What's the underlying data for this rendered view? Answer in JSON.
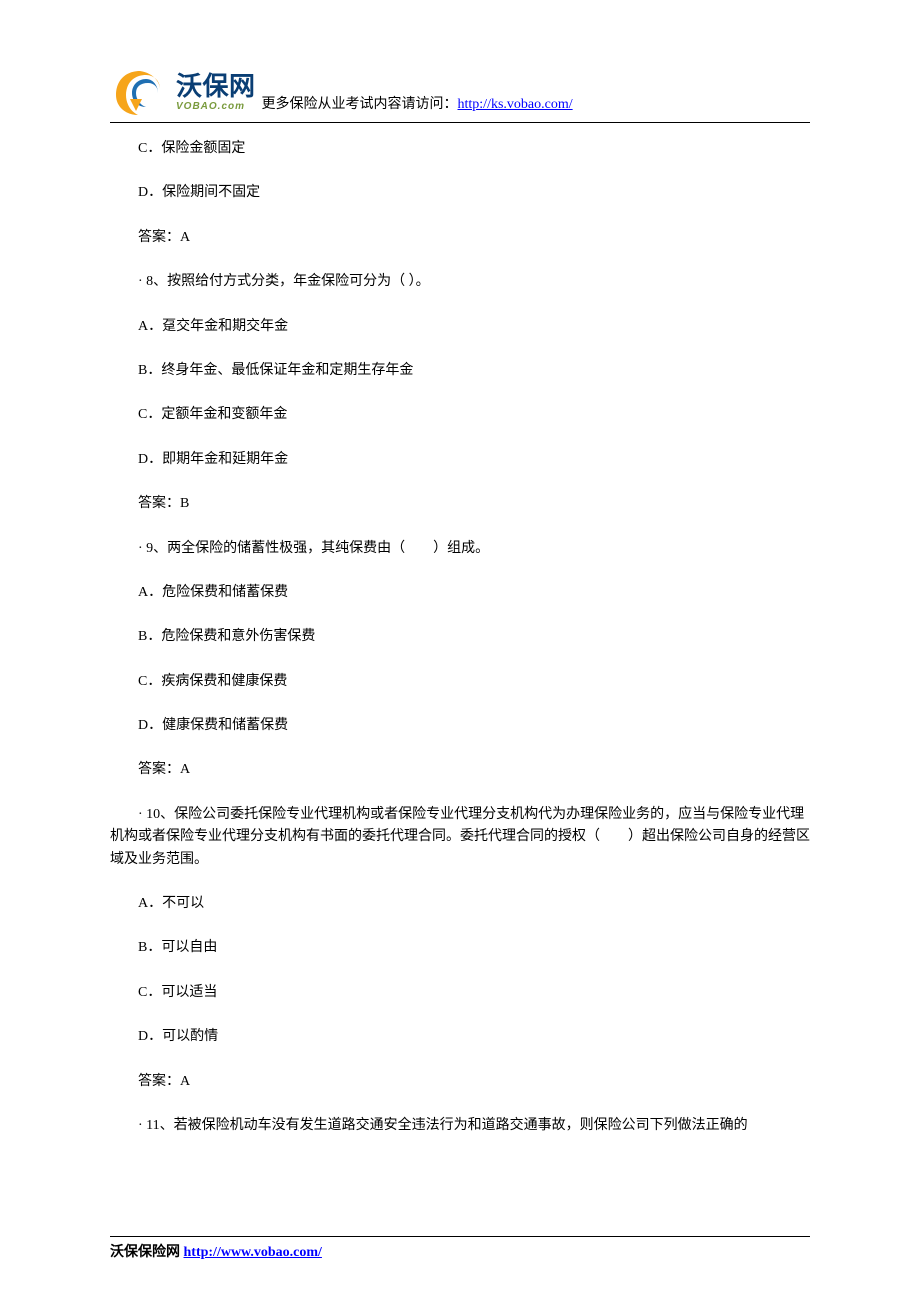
{
  "brand": {
    "name_cn": "沃保网",
    "name_en": "VOBAO.com"
  },
  "header": {
    "prefix": "更多保险从业考试内容请访问：",
    "link_text": "http://ks.vobao.com/",
    "link_href": "http://ks.vobao.com/"
  },
  "content": {
    "prev_c": "C．保险金额固定",
    "prev_d": "D．保险期间不固定",
    "prev_ans": "答案：A",
    "q8": "·  8、按照给付方式分类，年金保险可分为（ ）。",
    "q8_a": "A．趸交年金和期交年金",
    "q8_b": "B．终身年金、最低保证年金和定期生存年金",
    "q8_c": "C．定额年金和变额年金",
    "q8_d": "D．即期年金和延期年金",
    "q8_ans": "答案：B",
    "q9": "·  9、两全保险的储蓄性极强，其纯保费由（　　）组成。",
    "q9_a": "A．危险保费和储蓄保费",
    "q9_b": "B．危险保费和意外伤害保费",
    "q9_c": "C．疾病保费和健康保费",
    "q9_d": "D．健康保费和储蓄保费",
    "q9_ans": "答案：A",
    "q10": "·  10、保险公司委托保险专业代理机构或者保险专业代理分支机构代为办理保险业务的，应当与保险专业代理机构或者保险专业代理分支机构有书面的委托代理合同。委托代理合同的授权（　　）超出保险公司自身的经营区域及业务范围。",
    "q10_a": "A．不可以",
    "q10_b": "B．可以自由",
    "q10_c": "C．可以适当",
    "q10_d": "D．可以酌情",
    "q10_ans": "答案：A",
    "q11": "·  11、若被保险机动车没有发生道路交通安全违法行为和道路交通事故，则保险公司下列做法正确的"
  },
  "footer": {
    "label": "沃保保险网 ",
    "link_text": "http://www.vobao.com/",
    "link_href": "http://www.vobao.com/"
  }
}
